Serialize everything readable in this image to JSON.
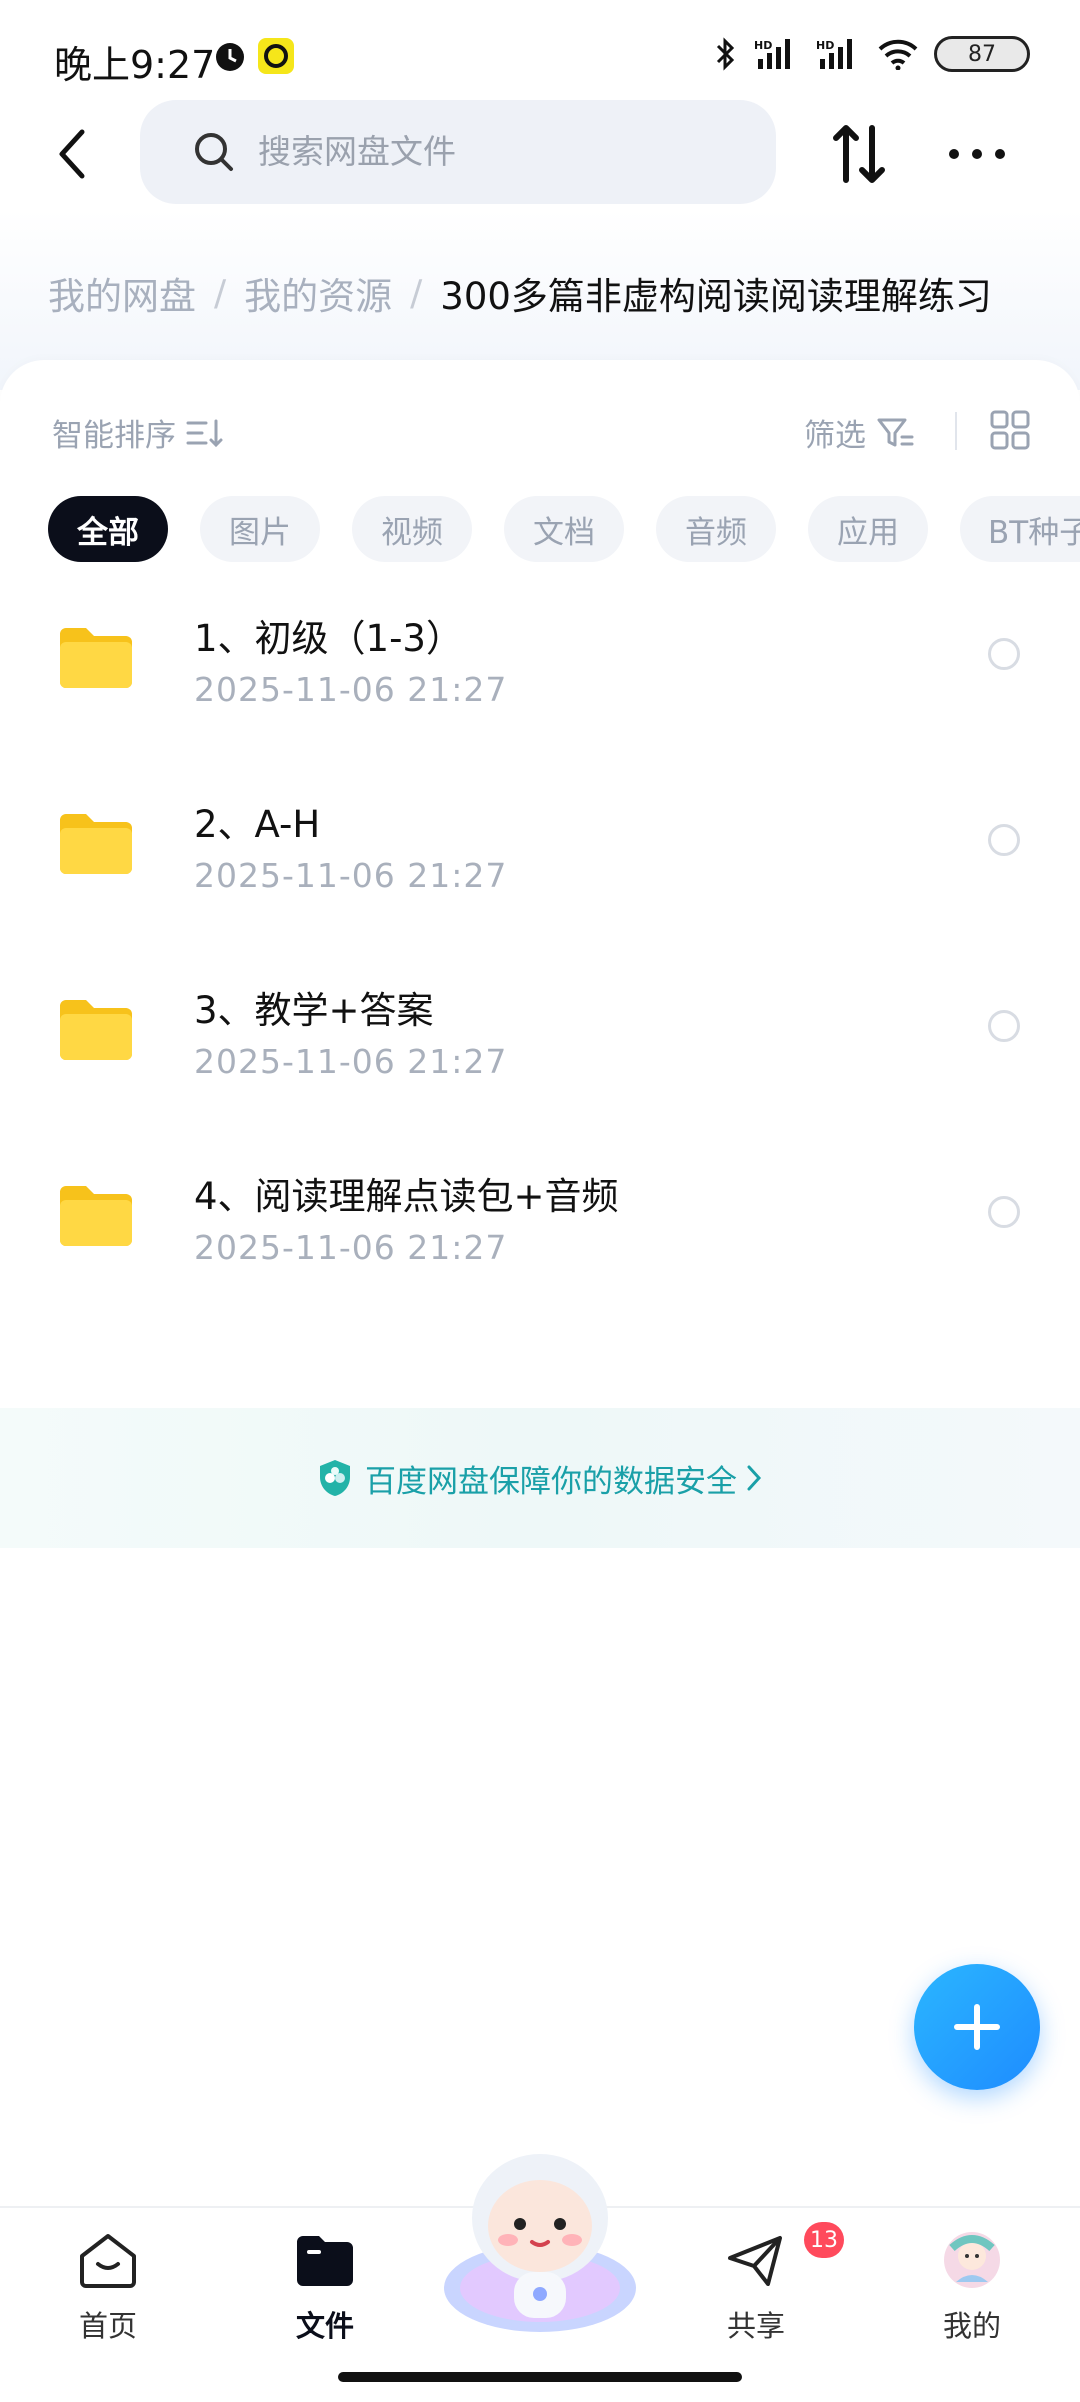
{
  "status_bar": {
    "time": "晚上9:27",
    "battery": "87"
  },
  "search": {
    "placeholder": "搜索网盘文件"
  },
  "breadcrumb": {
    "items": [
      "我的网盘",
      "我的资源"
    ],
    "current": "300多篇非虚构阅读阅读理解练习"
  },
  "toolbar": {
    "sort_label": "智能排序",
    "filter_label": "筛选"
  },
  "chips": [
    "全部",
    "图片",
    "视频",
    "文档",
    "音频",
    "应用",
    "BT种子"
  ],
  "files": [
    {
      "name": "1、初级（1-3）",
      "date": "2025-11-06   21:27"
    },
    {
      "name": "2、A-H",
      "date": "2025-11-06   21:27"
    },
    {
      "name": "3、教学+答案",
      "date": "2025-11-06   21:27"
    },
    {
      "name": "4、阅读理解点读包+音频",
      "date": "2025-11-06   21:27"
    }
  ],
  "banner": {
    "text": "百度网盘保障你的数据安全"
  },
  "nav": {
    "home": "首页",
    "files": "文件",
    "share": "共享",
    "share_badge": "13",
    "mine": "我的"
  },
  "colors": {
    "accent": "#1e8cff",
    "folder": "#ffd23f",
    "banner_text": "#1aa0a8",
    "badge": "#ff4a5c"
  }
}
